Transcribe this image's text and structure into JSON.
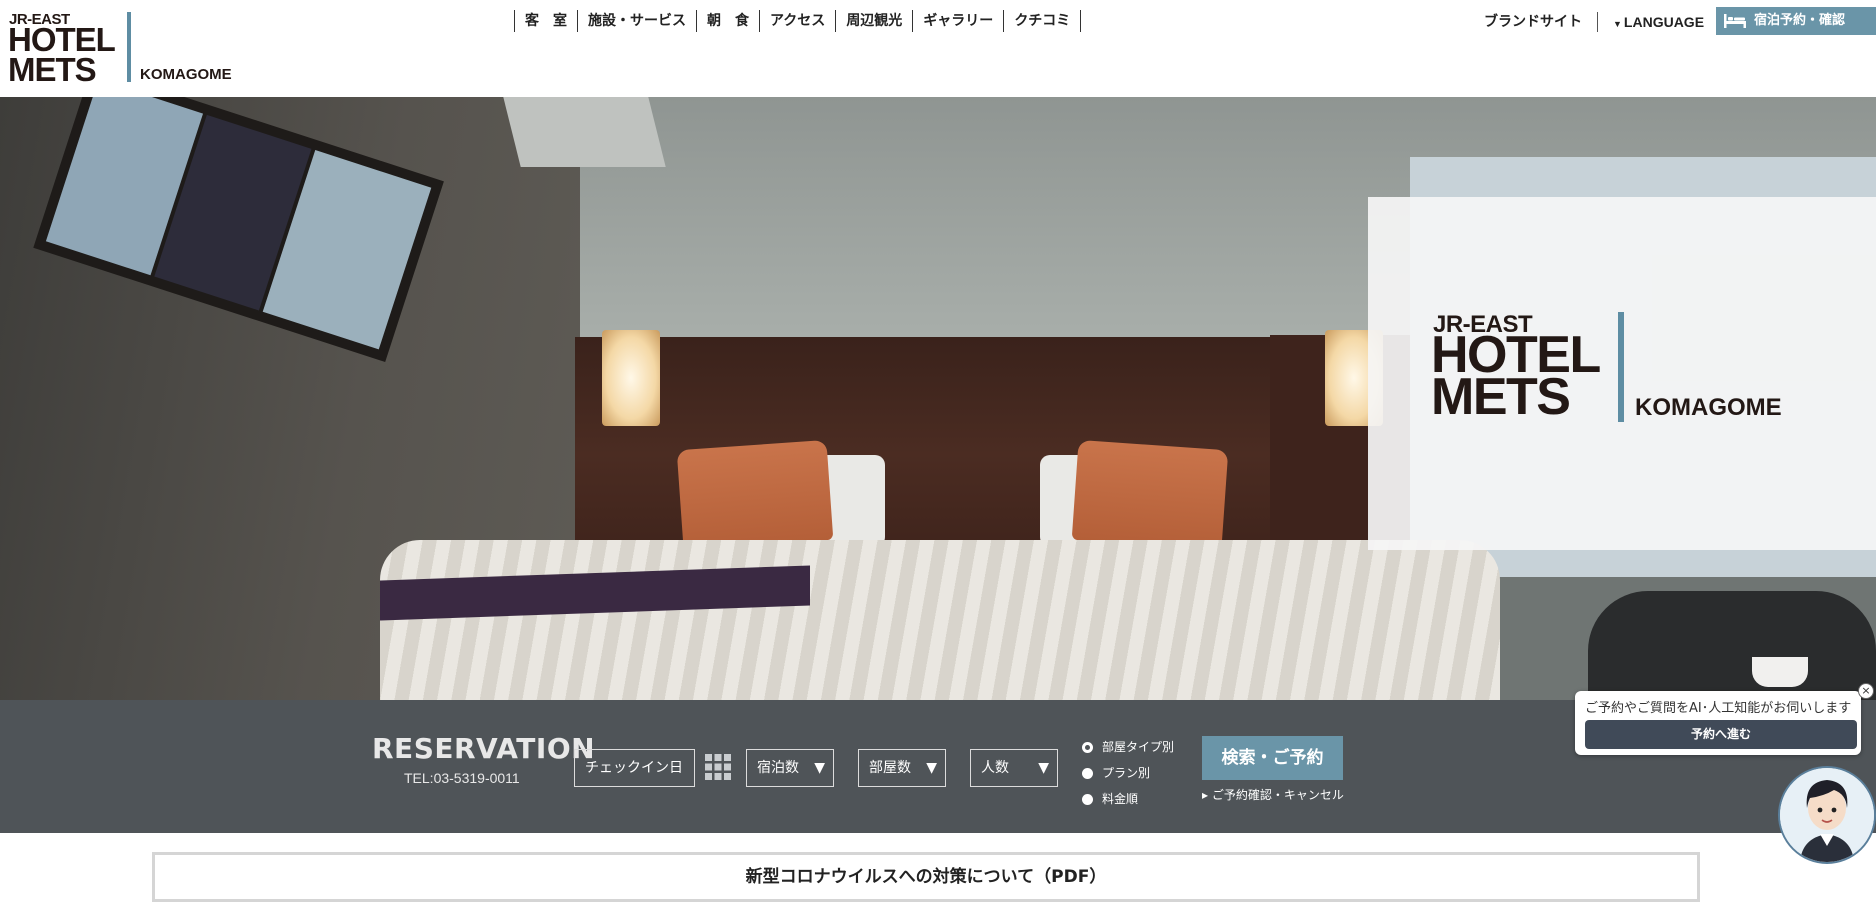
{
  "logo": {
    "line1": "JR-EAST",
    "line2": "HOTEL",
    "line3": "METS",
    "line4": "KOMAGOME"
  },
  "nav": {
    "items": [
      "客　室",
      "施設・サービス",
      "朝　食",
      "アクセス",
      "周辺観光",
      "ギャラリー",
      "クチコミ"
    ],
    "brand_site": "ブランドサイト",
    "language": "LANGUAGE",
    "booking": "宿泊予約・確認"
  },
  "reservation": {
    "title": "RESERVATION",
    "tel": "TEL:03-5319-0011",
    "checkin": "チェックイン日",
    "nights": "宿泊数",
    "rooms": "部屋数",
    "people": "人数",
    "sort_options": [
      "部屋タイプ別",
      "プラン別",
      "料金順"
    ],
    "selected_sort": "部屋タイプ別",
    "search_button": "検索・ご予約",
    "confirm_link": "ご予約確認・キャンセル"
  },
  "notice": {
    "text": "新型コロナウイルスへの対策について（PDF）"
  },
  "chat_widget": {
    "message": "ご予約やご質問をAI･人工知能がお伺いします",
    "button": "予約へ進む",
    "close": "×"
  },
  "colors": {
    "accent": "#6a95a8",
    "reservation_bg": "#4f5458",
    "logo_bar": "#5e8da3"
  }
}
